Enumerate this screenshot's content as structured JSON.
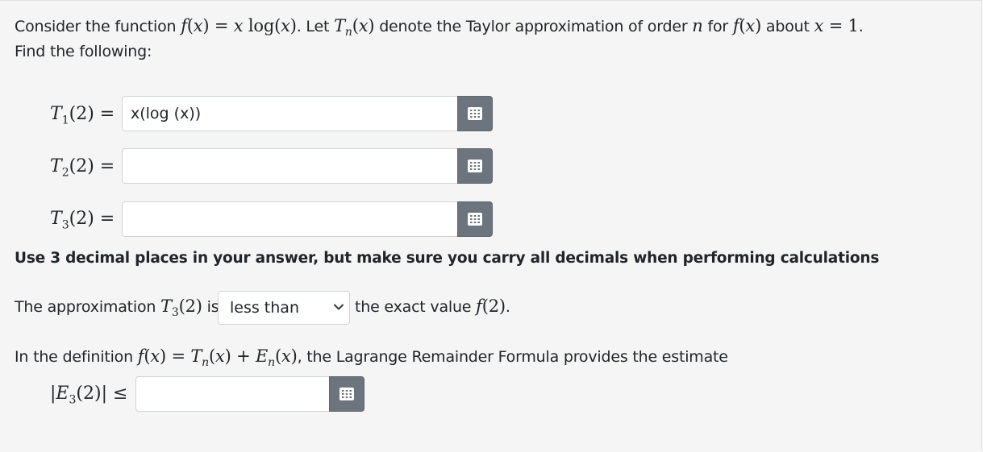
{
  "intro": {
    "part1": "Consider the function ",
    "fx": "f(x) = x log(x)",
    "part2": ". Let ",
    "tn": "Tn(x)",
    "part3": " denote the Taylor approximation of order ",
    "n": "n",
    "part4": " for ",
    "fx2": "f(x)",
    "part5": " about ",
    "x1": "x = 1",
    "part6": ".",
    "line2": "Find the following:"
  },
  "answers": [
    {
      "label": "T1(2) =",
      "value": "x(log (x))",
      "placeholder": ""
    },
    {
      "label": "T2(2) =",
      "value": "",
      "placeholder": ""
    },
    {
      "label": "T3(2) =",
      "value": "",
      "placeholder": ""
    }
  ],
  "note": "Use 3 decimal places in your answer, but make sure you carry all decimals when performing calculations",
  "comparison": {
    "prefix": "The approximation ",
    "t3": "T3(2)",
    "is": " is",
    "selected": "less than",
    "suffix": " the exact value ",
    "f2": "f(2)",
    "period": "."
  },
  "remainder": {
    "prefix": "In the definition ",
    "formula": "f(x) = Tn(x) + En(x)",
    "suffix": ", the Lagrange Remainder Formula provides the estimate",
    "label": "|E3(2)| ≤",
    "value": "",
    "placeholder": ""
  },
  "icons": {
    "math_button": "keypad-grid-icon",
    "dropdown": "chevron-down-icon"
  },
  "colors": {
    "background": "#f5f5f5",
    "button": "#6c757d",
    "text": "#212529"
  }
}
